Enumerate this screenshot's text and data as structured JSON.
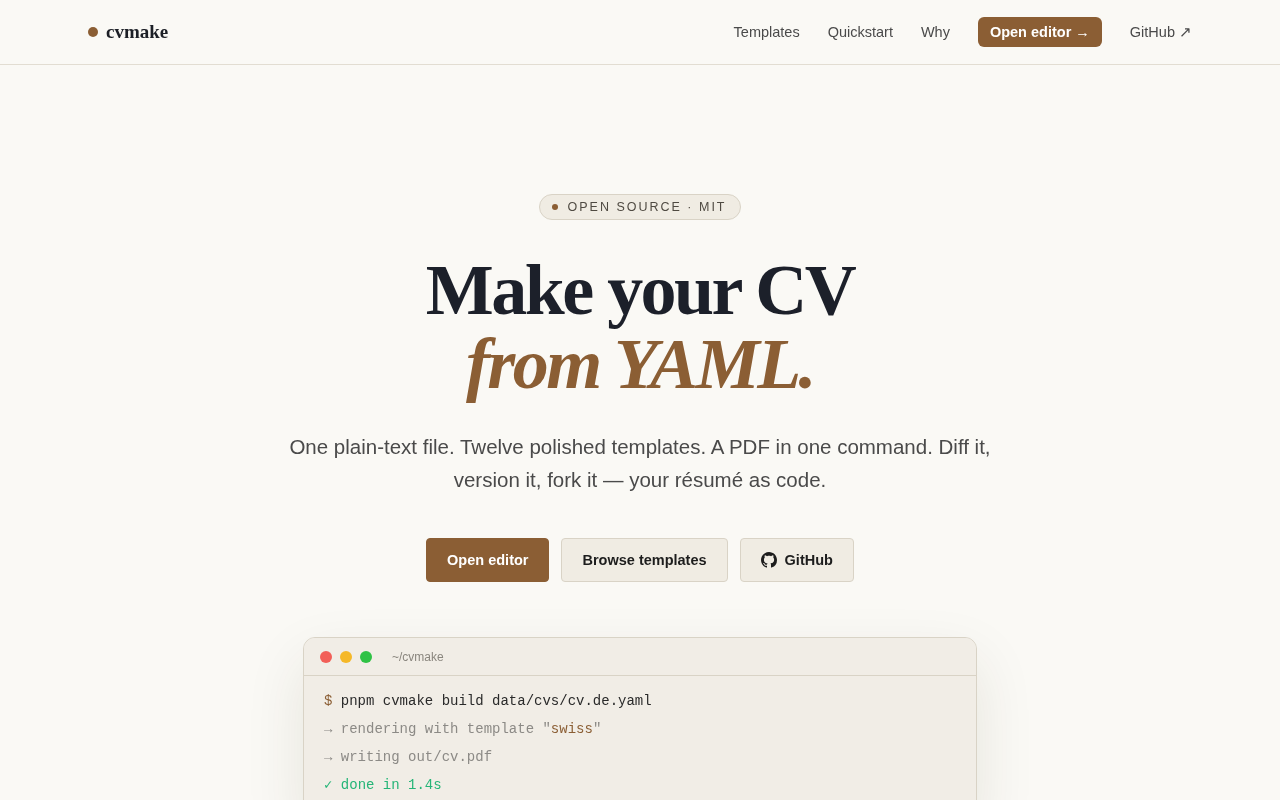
{
  "header": {
    "logo": "cvmake",
    "nav": [
      {
        "label": "Templates",
        "kind": "link"
      },
      {
        "label": "Quickstart",
        "kind": "link"
      },
      {
        "label": "Why",
        "kind": "link"
      },
      {
        "label": "Open editor →",
        "kind": "button"
      },
      {
        "label": "GitHub ↗",
        "kind": "link"
      }
    ]
  },
  "hero": {
    "badge": "OPEN SOURCE · MIT",
    "title": [
      {
        "text": "Make your CV",
        "kind": "plain"
      },
      {
        "text": "from YAML.",
        "kind": "accent"
      }
    ],
    "subtitle": "One plain-text file. Twelve polished templates. A PDF in one command. Diff it, version it, fork it — your résumé as code.",
    "buttons": [
      {
        "label": "Open editor",
        "kind": "primary"
      },
      {
        "label": "Browse templates",
        "kind": "secondary"
      },
      {
        "label": "GitHub",
        "kind": "icon"
      }
    ]
  },
  "terminal": {
    "window_controls": [
      {
        "color": "#f25f58"
      },
      {
        "color": "#f5b828"
      },
      {
        "color": "#2fc245"
      }
    ],
    "title": "~/cvmake",
    "lines": [
      {
        "kind": "command",
        "prompt": "$",
        "parts": [
          {
            "kind": "plain",
            "text": "pnpm cvmake build data/cvs/cv.de.yaml"
          }
        ]
      },
      {
        "kind": "info",
        "prompt": "→",
        "parts": [
          {
            "kind": "plain",
            "text": "rendering with template \""
          },
          {
            "kind": "string",
            "text": "swiss"
          },
          {
            "kind": "plain",
            "text": "\""
          }
        ]
      },
      {
        "kind": "info",
        "prompt": "→",
        "parts": [
          {
            "kind": "plain",
            "text": "writing out/cv.pdf"
          }
        ]
      },
      {
        "kind": "success",
        "prompt": "✓",
        "parts": [
          {
            "kind": "plain",
            "text": "done in 1.4s"
          }
        ]
      }
    ]
  }
}
